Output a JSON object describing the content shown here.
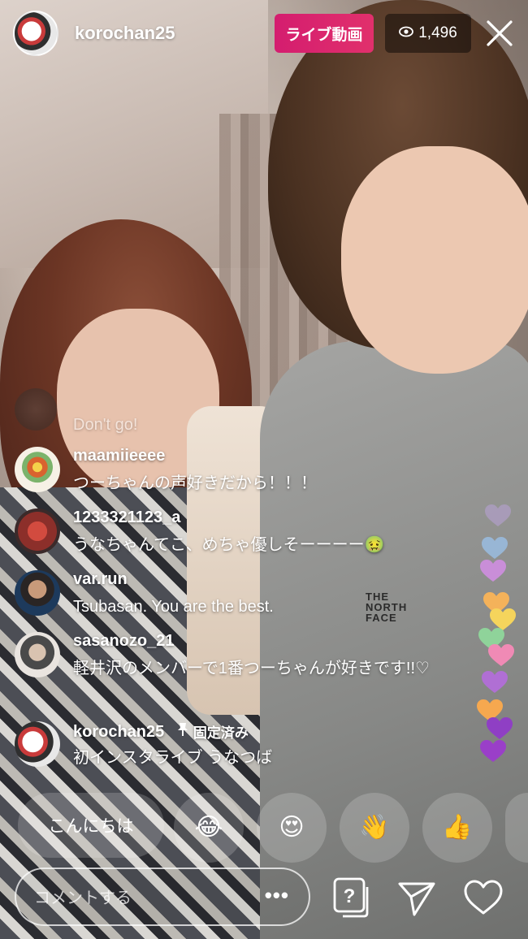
{
  "header": {
    "username": "korochan25",
    "live_label": "ライブ動画",
    "viewer_count": "1,496",
    "colors": {
      "live_badge": "#e1306c"
    }
  },
  "comments": [
    {
      "username": "",
      "text": "Don't go!",
      "faded": true
    },
    {
      "username": "maamiieeee",
      "text": "つーちゃんの声好きだから！！！"
    },
    {
      "username": "1233321123_a",
      "text": "うなちゃんてこ、めちゃ優しそーーーー🤢"
    },
    {
      "username": "var.run",
      "text": "Tsubasan. You are the best."
    },
    {
      "username": "sasanozo_21",
      "text": "軽井沢のメンバーで1番つーちゃんが好きです!!♡"
    },
    {
      "username": "korochan25",
      "pinned_label": "固定済み",
      "text": "初インスタライブ うなつば"
    }
  ],
  "quick_replies": {
    "greeting": "こんにちは",
    "emojis": [
      "😂",
      "😍",
      "👋",
      "👍"
    ]
  },
  "bottom_bar": {
    "comment_placeholder": "コメントする",
    "more_label": "•••"
  },
  "video": {
    "shirt_logo": "THE\nNORTH\nFACE"
  }
}
